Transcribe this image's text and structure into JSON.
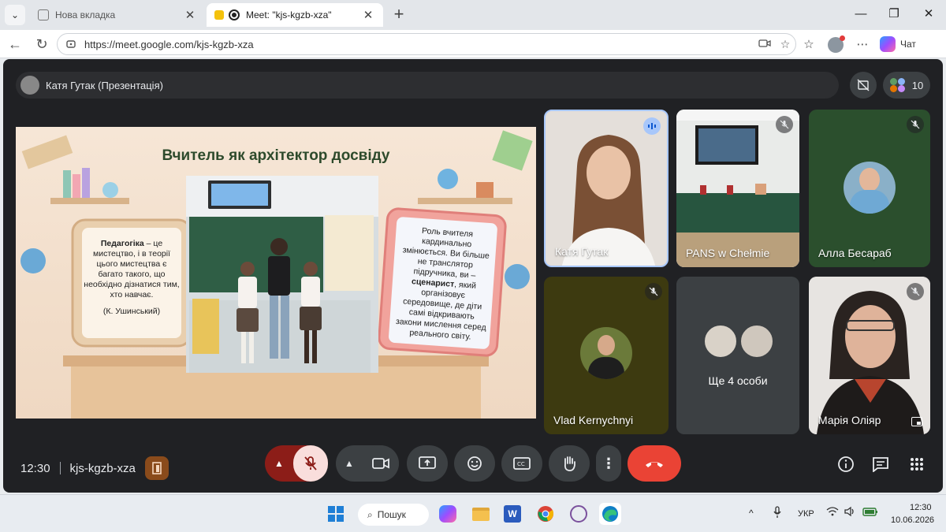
{
  "browser": {
    "tabs": [
      {
        "title": "Нова вкладка",
        "active": false
      },
      {
        "title": "Meet: \"kjs-kgzb-xza\"",
        "active": true
      }
    ],
    "url": "https://meet.google.com/kjs-kgzb-xza",
    "copilot_label": "Чат"
  },
  "meet": {
    "presenter_label": "Катя Гутак (Презентація)",
    "participants_count": "10",
    "slide": {
      "title": "Вчитель як архітектор досвіду",
      "left_card": {
        "bold": "Педагогіка",
        "text": " – це мистецтво, і в теорії цього мистецтва є багато такого, що необхідно дізнатися тим, хто навчає.",
        "author": "(К. Ушинський)"
      },
      "right_card": {
        "text1": "Роль вчителя кардинально змінюється. Ви більше не транслятор підручника, ви –",
        "bold": "сценарист",
        "text2": ", який організовує середовище, де діти самі відкривають закони мислення серед реального світу."
      }
    },
    "tiles": [
      {
        "name": "Катя Гутак",
        "speaking": true
      },
      {
        "name": "PANS w Chełmie",
        "muted": true
      },
      {
        "name": "Алла Бесараб",
        "muted": true
      },
      {
        "name": "Vlad Kernychnyi",
        "muted": true
      },
      {
        "name": "Ще 4 особи"
      },
      {
        "name": "Марія Оліяр",
        "muted": true
      }
    ],
    "toolbar": {
      "time": "12:30",
      "meeting_code": "kjs-kgzb-xza"
    }
  },
  "taskbar": {
    "search_label": "Пошук",
    "lang": "УКР",
    "clock_time": "12:30",
    "clock_date": "10.06.2026"
  },
  "colors": {
    "meet_bg": "#202124",
    "end_call": "#ea4335",
    "mic_muted_bg": "#f9dedc",
    "muted_accent": "#8c1d18"
  }
}
